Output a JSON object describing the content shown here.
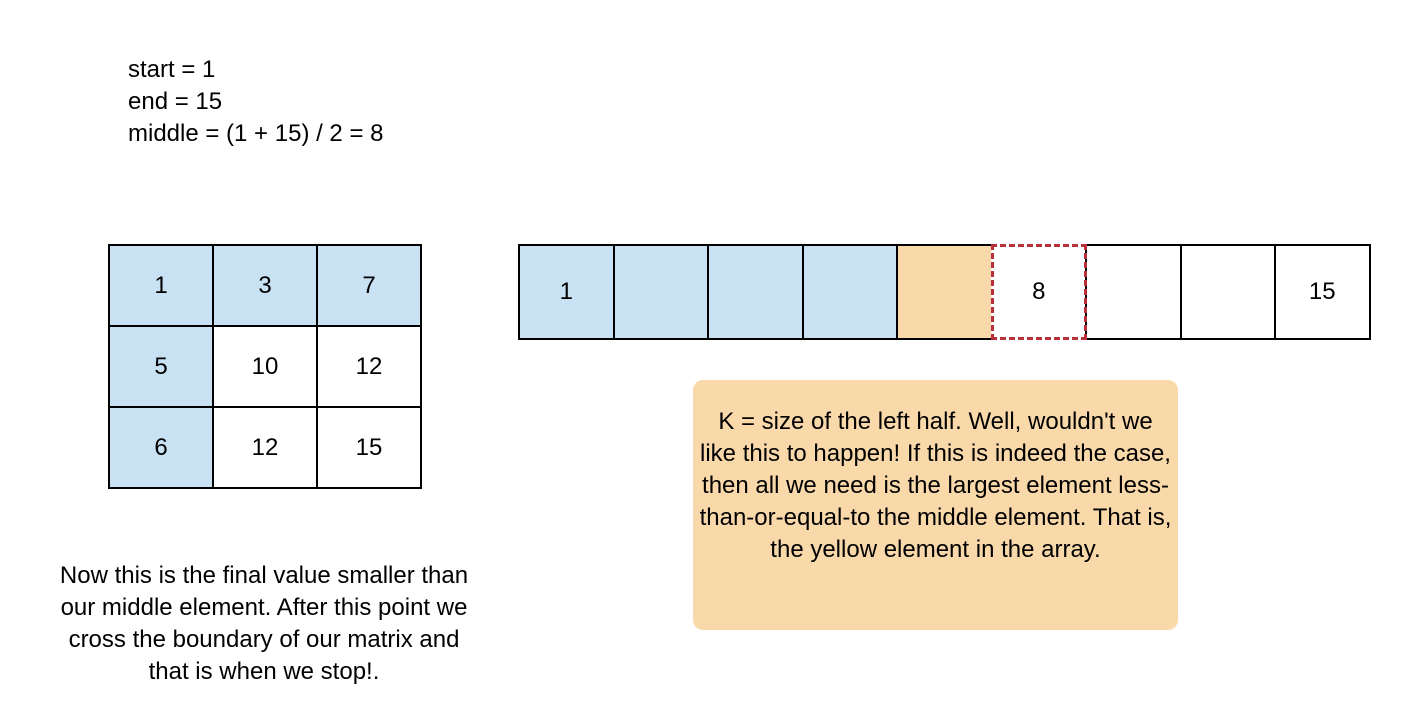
{
  "variables": {
    "start": "start = 1",
    "end": "end = 15",
    "middle": "middle = (1 + 15) / 2 = 8"
  },
  "matrix": {
    "rows": [
      [
        "1",
        "3",
        "7"
      ],
      [
        "5",
        "10",
        "12"
      ],
      [
        "6",
        "12",
        "15"
      ]
    ],
    "highlighted": [
      [
        true,
        true,
        true
      ],
      [
        true,
        false,
        false
      ],
      [
        true,
        false,
        false
      ]
    ]
  },
  "array": {
    "cells": [
      "1",
      "",
      "",
      "",
      "",
      "8",
      "",
      "",
      "15"
    ],
    "fill": [
      "blue",
      "blue",
      "blue",
      "blue",
      "orange",
      "white",
      "white",
      "white",
      "white"
    ],
    "middle_index": 5
  },
  "notes": {
    "right": "K = size of the left half. Well, wouldn't we like this to happen! If this is indeed the case, then all we need is the largest element less-than-or-equal-to the middle element. That is, the yellow element in the array.",
    "left": "Now this is the final value smaller than our middle element. After this point we cross the boundary of our matrix and that is when we stop!."
  },
  "colors": {
    "blue": "#c8e2f4",
    "orange": "#f9d9aa",
    "white": "#ffffff",
    "middle_dash": "#b8303a"
  }
}
